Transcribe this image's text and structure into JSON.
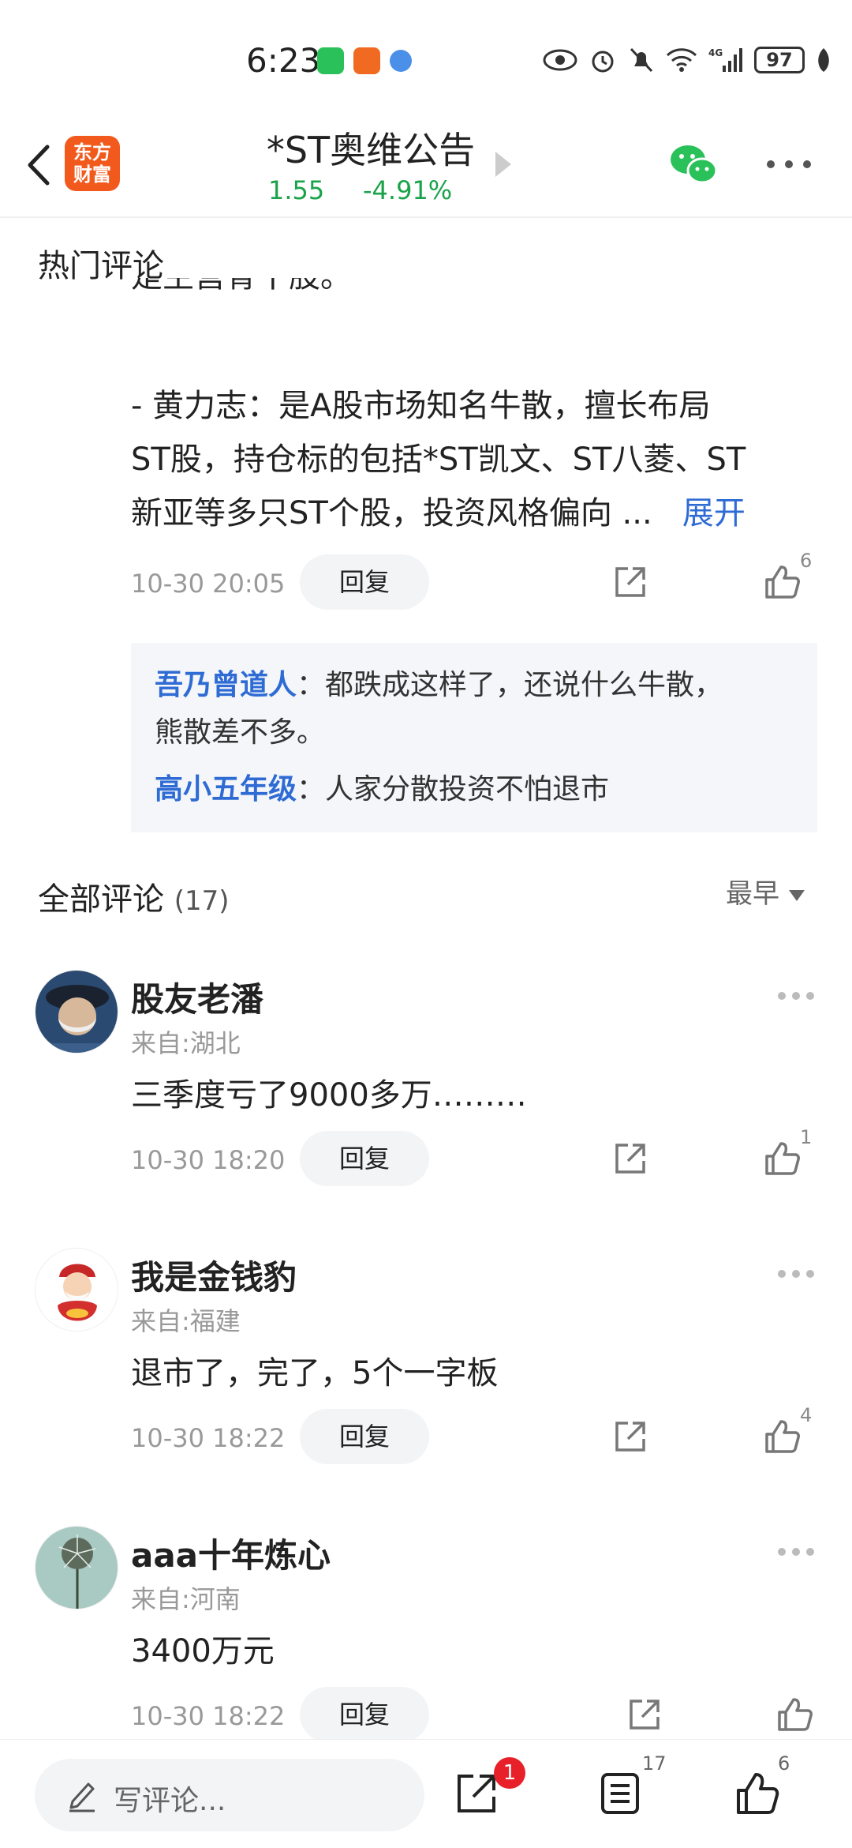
{
  "status": {
    "time": "6:23",
    "battery": "97",
    "network": "4G"
  },
  "header": {
    "brand": [
      "东方",
      "财富"
    ],
    "title": "*ST奥维公告",
    "price": "1.55",
    "change": "-4.91%"
  },
  "hot_section": {
    "title": "热门评论",
    "cut_text": "是主营骨干股。",
    "lines": [
      "- 黄力志：是A股市场知名牛散，擅长布局",
      "ST股，持仓标的包括*ST凯文、ST八菱、ST",
      "新亚等多只ST个股，投资风格偏向 ..."
    ],
    "expand": "展开",
    "time": "10-30 20:05",
    "reply": "回复",
    "likes": "6",
    "sub_replies": [
      {
        "name": "吾乃曾道人",
        "sep": "：",
        "text_1": "都跌成这样了，还说什么牛散，",
        "text_2": "熊散差不多。"
      },
      {
        "name": "高小五年级",
        "sep": "：",
        "text_1": "人家分散投资不怕退市"
      }
    ]
  },
  "all_section": {
    "title": "全部评论",
    "count": "(17)",
    "sort": "最早"
  },
  "comments": [
    {
      "name": "股友老潘",
      "location": "来自:湖北",
      "text": "三季度亏了9000多万………",
      "time": "10-30 18:20",
      "reply": "回复",
      "likes": "1"
    },
    {
      "name": "我是金钱豹",
      "location": "来自:福建",
      "text": "退市了，完了，5个一字板",
      "time": "10-30 18:22",
      "reply": "回复",
      "likes": "4"
    },
    {
      "name": "aaa十年炼心",
      "location": "来自:河南",
      "text": "3400万元",
      "time": "10-30 18:22",
      "reply": "回复",
      "likes": ""
    }
  ],
  "bottom_bar": {
    "placeholder": "写评论...",
    "share_badge": "1",
    "comment_count": "17",
    "like_count": "6"
  },
  "colors": {
    "price_green": "#1aa34a",
    "link_blue": "#2e6bd4",
    "brand_orange": "#f25a1d",
    "badge_red": "#e8202a"
  }
}
